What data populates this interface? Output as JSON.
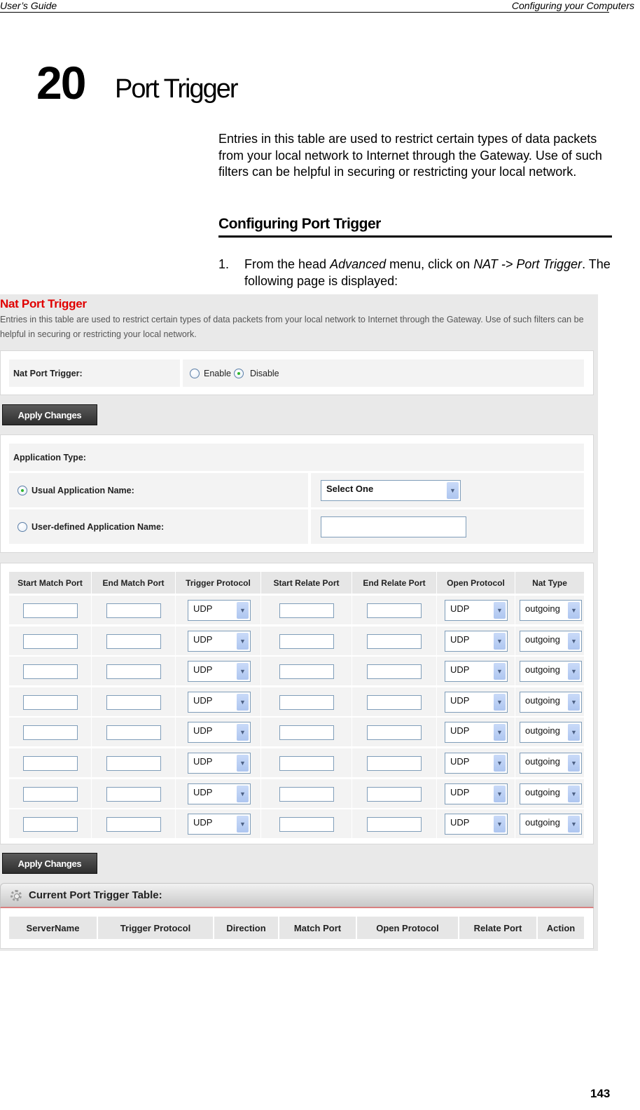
{
  "running_header": {
    "left": "User’s Guide",
    "right": "Configuring your Computers"
  },
  "chapter": {
    "number": "20",
    "title": "Port Trigger"
  },
  "intro": "Entries in this table are used to restrict certain types of data packets from your local network to Internet through the Gateway. Use of such filters can be helpful in securing or restricting your local network.",
  "section_heading": "Configuring Port Trigger",
  "step": {
    "number": "1.",
    "pre": "From the head ",
    "menu": "Advanced",
    "mid": " menu, click on ",
    "path": "NAT -> Port Trigger",
    "post": ". The following page is displayed:"
  },
  "ui": {
    "title": "Nat Port Trigger",
    "description": "Entries in this table are used to restrict certain types of data packets from your local network to Internet through the Gateway. Use of such filters can be helpful in securing or restricting your local network.",
    "nat_trigger": {
      "label": "Nat Port Trigger:",
      "options": [
        "Enable",
        "Disable"
      ],
      "selected": "Disable"
    },
    "apply_label": "Apply Changes",
    "app_type": {
      "label": "Application Type:",
      "usual_label": "Usual Application Name:",
      "usual_selected": "Select One",
      "user_defined_label": "User-defined Application Name:",
      "user_defined_value": "",
      "selected": "usual"
    },
    "port_table": {
      "headers": [
        "Start Match Port",
        "End Match Port",
        "Trigger Protocol",
        "Start Relate Port",
        "End Relate Port",
        "Open Protocol",
        "Nat Type"
      ],
      "rows": [
        {
          "start_match": "",
          "end_match": "",
          "trigger_protocol": "UDP",
          "start_relate": "",
          "end_relate": "",
          "open_protocol": "UDP",
          "nat_type": "outgoing"
        },
        {
          "start_match": "",
          "end_match": "",
          "trigger_protocol": "UDP",
          "start_relate": "",
          "end_relate": "",
          "open_protocol": "UDP",
          "nat_type": "outgoing"
        },
        {
          "start_match": "",
          "end_match": "",
          "trigger_protocol": "UDP",
          "start_relate": "",
          "end_relate": "",
          "open_protocol": "UDP",
          "nat_type": "outgoing"
        },
        {
          "start_match": "",
          "end_match": "",
          "trigger_protocol": "UDP",
          "start_relate": "",
          "end_relate": "",
          "open_protocol": "UDP",
          "nat_type": "outgoing"
        },
        {
          "start_match": "",
          "end_match": "",
          "trigger_protocol": "UDP",
          "start_relate": "",
          "end_relate": "",
          "open_protocol": "UDP",
          "nat_type": "outgoing"
        },
        {
          "start_match": "",
          "end_match": "",
          "trigger_protocol": "UDP",
          "start_relate": "",
          "end_relate": "",
          "open_protocol": "UDP",
          "nat_type": "outgoing"
        },
        {
          "start_match": "",
          "end_match": "",
          "trigger_protocol": "UDP",
          "start_relate": "",
          "end_relate": "",
          "open_protocol": "UDP",
          "nat_type": "outgoing"
        },
        {
          "start_match": "",
          "end_match": "",
          "trigger_protocol": "UDP",
          "start_relate": "",
          "end_relate": "",
          "open_protocol": "UDP",
          "nat_type": "outgoing"
        }
      ]
    },
    "current_table": {
      "title": "Current Port Trigger Table:",
      "icon": "gear-icon",
      "headers": [
        "ServerName",
        "Trigger Protocol",
        "Direction",
        "Match Port",
        "Open Protocol",
        "Relate Port",
        "Action"
      ]
    },
    "colors": {
      "title_red": "#e00000",
      "background": "#e9e9e9",
      "radio_green": "#2db52d"
    }
  },
  "page_number": "143"
}
